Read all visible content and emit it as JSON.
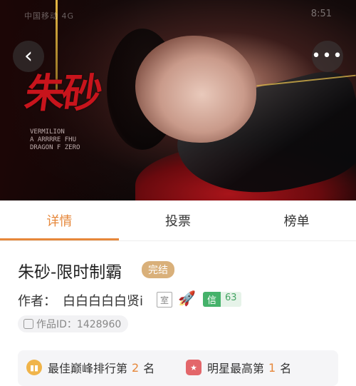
{
  "status_bar": {
    "left": "中国移动 4G",
    "time": "8:51"
  },
  "hero": {
    "title_art": "朱砂",
    "caption_lines": [
      "VERMILION",
      "A ARRRRE FHU",
      "DRAGON F ZERO"
    ]
  },
  "nav": {
    "back_icon": "‹",
    "more_icon": "•••"
  },
  "tabs": [
    {
      "label": "详情",
      "active": true
    },
    {
      "label": "投票",
      "active": false
    },
    {
      "label": "榜单",
      "active": false
    }
  ],
  "work": {
    "title": "朱砂-限时制霸",
    "status": "完结",
    "author_label": "作者：",
    "author_name": "白白白白白贤i",
    "tag": "室",
    "level_label": "信",
    "level_value": "63",
    "id_text": "作品ID：1428960"
  },
  "rankings": [
    {
      "prefix": "最佳巅峰排行第",
      "value": "2",
      "suffix": "名"
    },
    {
      "prefix": "明星最高第",
      "value": "1",
      "suffix": "名"
    }
  ],
  "colors": {
    "accent": "#e6873a",
    "badge": "#d9b07a",
    "level": "#45b26a"
  }
}
